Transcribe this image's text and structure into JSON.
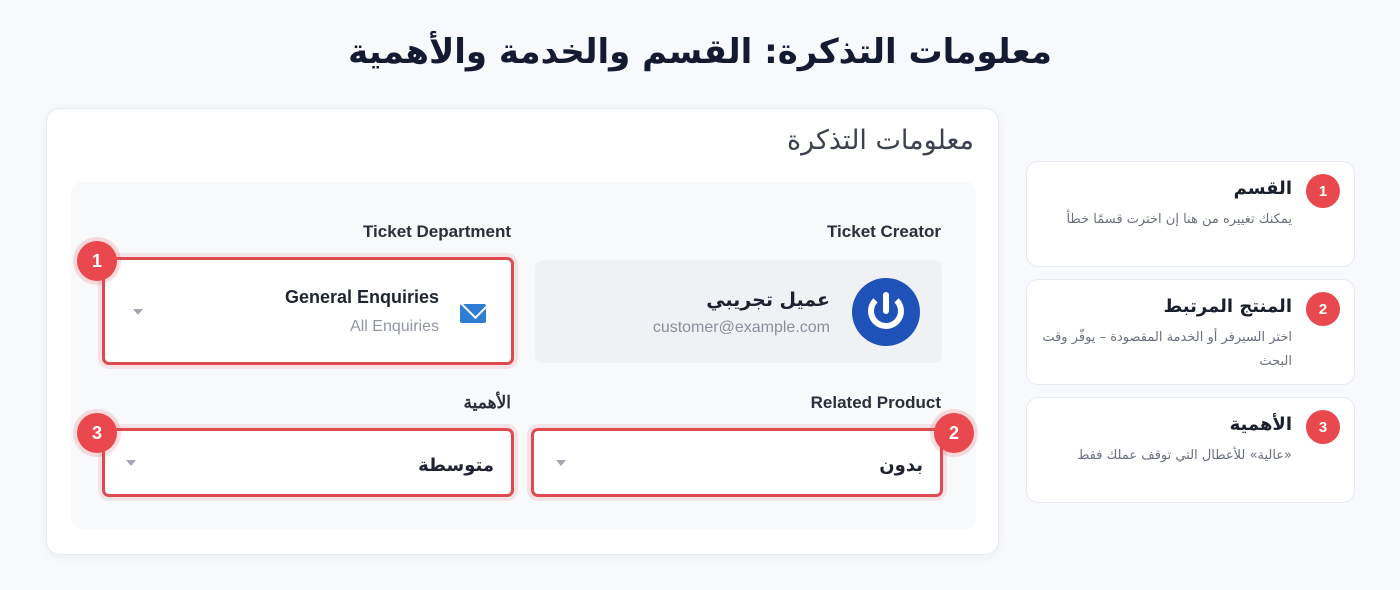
{
  "page_title": "معلومات التذكرة: القسم والخدمة والأهمية",
  "card": {
    "title": "معلومات التذكرة",
    "creator": {
      "label": "Ticket Creator",
      "name": "عميل تجريبي",
      "email": "customer@example.com"
    },
    "department": {
      "label": "Ticket Department",
      "value": "General Enquiries",
      "sub": "All Enquiries",
      "icon": "mail-icon"
    },
    "related_product": {
      "label": "Related Product",
      "value": "بدون"
    },
    "priority": {
      "label": "الأهمية",
      "value": "متوسطة"
    },
    "badges": [
      "1",
      "2",
      "3"
    ]
  },
  "side_notes": [
    {
      "number": "1",
      "title": "القسم",
      "desc": "يمكنك تغييره من هنا إن اخترت قسمًا خطأ"
    },
    {
      "number": "2",
      "title": "المنتج المرتبط",
      "desc": "اختر السيرفر أو الخدمة المقصودة – يوفّر وقت البحث"
    },
    {
      "number": "3",
      "title": "الأهمية",
      "desc": "«عالية» للأعطال التي توقف عملك فقط"
    }
  ],
  "colors": {
    "accent_red": "#e8484e",
    "avatar_blue": "#1e52b8",
    "mail_blue": "#2e7fd4"
  }
}
